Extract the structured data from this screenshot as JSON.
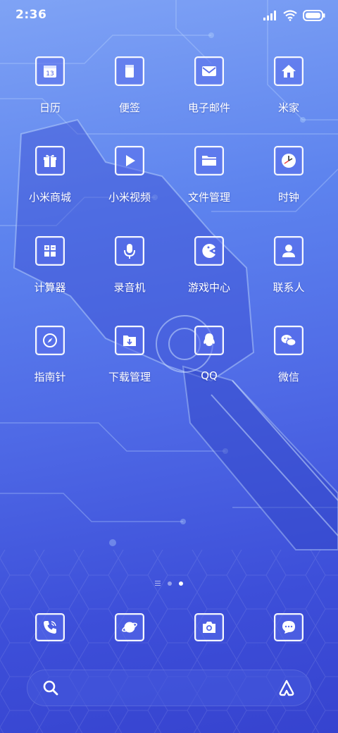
{
  "status": {
    "time": "2:36"
  },
  "apps": [
    {
      "label": "日历",
      "icon": "calendar-icon",
      "calendar_day": "13"
    },
    {
      "label": "便签",
      "icon": "notes-icon"
    },
    {
      "label": "电子邮件",
      "icon": "mail-icon"
    },
    {
      "label": "米家",
      "icon": "home-icon"
    },
    {
      "label": "小米商城",
      "icon": "gift-icon"
    },
    {
      "label": "小米视频",
      "icon": "play-icon"
    },
    {
      "label": "文件管理",
      "icon": "folder-icon"
    },
    {
      "label": "时钟",
      "icon": "clock-icon"
    },
    {
      "label": "计算器",
      "icon": "calculator-icon"
    },
    {
      "label": "录音机",
      "icon": "microphone-icon"
    },
    {
      "label": "游戏中心",
      "icon": "game-icon"
    },
    {
      "label": "联系人",
      "icon": "contact-icon"
    },
    {
      "label": "指南针",
      "icon": "compass-icon"
    },
    {
      "label": "下载管理",
      "icon": "download-icon"
    },
    {
      "label": "QQ",
      "icon": "qq-icon"
    },
    {
      "label": "微信",
      "icon": "wechat-icon"
    }
  ],
  "dock": [
    {
      "icon": "phone-icon"
    },
    {
      "icon": "browser-icon"
    },
    {
      "icon": "camera-icon"
    },
    {
      "icon": "messages-icon"
    }
  ],
  "pager": {
    "pages": 2,
    "active_page": 2
  },
  "search": {
    "icon": "search-icon",
    "assistant_icon": "assistant-icon"
  },
  "colors": {
    "background_top": "#7fa3f5",
    "background_bottom": "#3643cf",
    "icon_fill": "#5a6eeb"
  }
}
